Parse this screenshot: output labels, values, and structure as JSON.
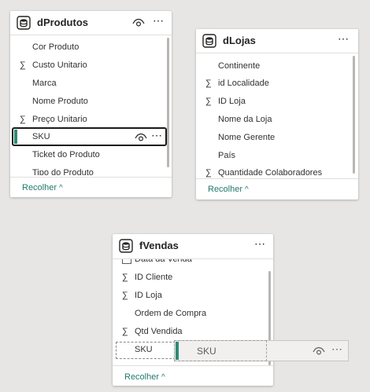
{
  "tables": [
    {
      "title": "dProdutos",
      "fields": [
        {
          "label": "Cor Produto",
          "sigma": false
        },
        {
          "label": "Custo Unitario",
          "sigma": true
        },
        {
          "label": "Marca",
          "sigma": false
        },
        {
          "label": "Nome Produto",
          "sigma": false
        },
        {
          "label": "Preço Unitario",
          "sigma": true
        },
        {
          "label": "SKU",
          "sigma": false,
          "selected": true
        },
        {
          "label": "Ticket do Produto",
          "sigma": false
        },
        {
          "label": "Tipo do Produto",
          "sigma": false
        }
      ],
      "collapse_label": "Recolher"
    },
    {
      "title": "dLojas",
      "fields": [
        {
          "label": "Continente",
          "sigma": false
        },
        {
          "label": "id Localidade",
          "sigma": true
        },
        {
          "label": "ID Loja",
          "sigma": true
        },
        {
          "label": "Nome da Loja",
          "sigma": false
        },
        {
          "label": "Nome Gerente",
          "sigma": false
        },
        {
          "label": "País",
          "sigma": false
        },
        {
          "label": "Quantidade Colaboradores",
          "sigma": true
        }
      ],
      "collapse_label": "Recolher"
    },
    {
      "title": "fVendas",
      "fields": [
        {
          "label": "Data da Venda",
          "sigma": false,
          "partial": true
        },
        {
          "label": "ID Cliente",
          "sigma": true
        },
        {
          "label": "ID Loja",
          "sigma": true
        },
        {
          "label": "Ordem de Compra",
          "sigma": false
        },
        {
          "label": "Qtd Vendida",
          "sigma": true
        },
        {
          "label": "SKU",
          "sigma": false,
          "drop_target": true
        }
      ],
      "collapse_label": "Recolher"
    }
  ],
  "drag_ghost": {
    "label": "SKU"
  },
  "symbols": {
    "sigma": "∑",
    "more": "⋯",
    "chevron_up": "^"
  },
  "colors": {
    "accent": "#2e8b74",
    "link": "#217a6e"
  }
}
